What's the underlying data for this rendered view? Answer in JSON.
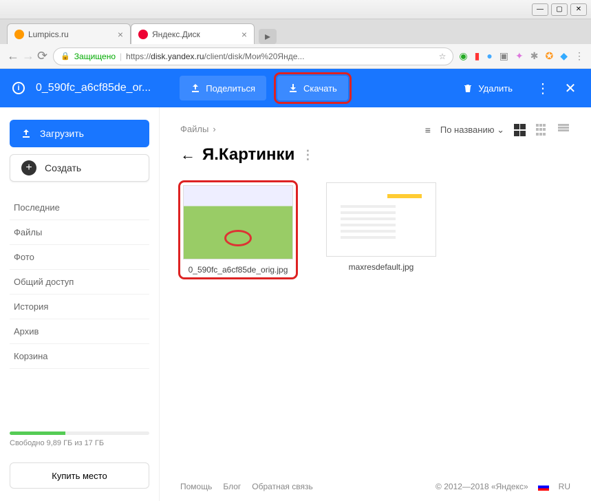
{
  "window": {
    "tabs": [
      {
        "title": "Lumpics.ru"
      },
      {
        "title": "Яндекс.Диск"
      }
    ]
  },
  "addressBar": {
    "secureLabel": "Защищено",
    "urlPrefix": "https://",
    "urlHost": "disk.yandex.ru",
    "urlPath": "/client/disk/Мои%20Янде..."
  },
  "toolbar": {
    "fileTitle": "0_590fc_a6cf85de_or...",
    "share": "Поделиться",
    "download": "Скачать",
    "delete": "Удалить"
  },
  "sidebar": {
    "upload": "Загрузить",
    "create": "Создать",
    "items": [
      "Последние",
      "Файлы",
      "Фото",
      "Общий доступ",
      "История",
      "Архив",
      "Корзина"
    ],
    "storageText": "Свободно 9,89 ГБ из 17 ГБ",
    "buy": "Купить место"
  },
  "content": {
    "breadcrumb": "Файлы",
    "sortLabel": "По названию",
    "folderTitle": "Я.Картинки",
    "files": [
      {
        "name": "0_590fc_a6cf85de_orig.jpg"
      },
      {
        "name": "maxresdefault.jpg"
      }
    ]
  },
  "footer": {
    "help": "Помощь",
    "blog": "Блог",
    "feedback": "Обратная связь",
    "copyright": "© 2012—2018 «Яндекс»",
    "lang": "RU"
  }
}
